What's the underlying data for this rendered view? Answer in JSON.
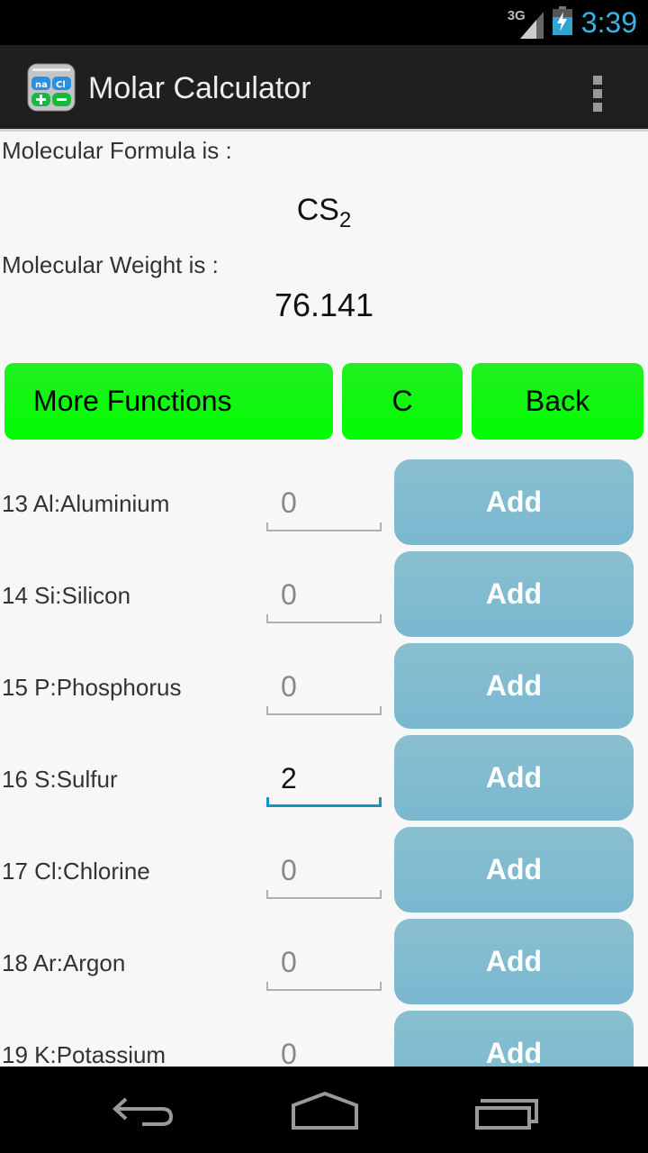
{
  "status_bar": {
    "network": "3G",
    "time": "3:39",
    "battery": "charging"
  },
  "action_bar": {
    "title": "Molar Calculator",
    "icon": "molar-calculator-app-icon",
    "overflow": "overflow-menu-icon"
  },
  "result": {
    "formula_label": "Molecular Formula is :",
    "formula_main": "CS",
    "formula_sub": "2",
    "weight_label": "Molecular Weight is :",
    "weight_value": "76.141"
  },
  "buttons": {
    "more_functions": "More Functions",
    "clear": "C",
    "back": "Back"
  },
  "colors": {
    "green_button": "#00ff00",
    "add_button": "#7ab8d0",
    "accent": "#33b5e5",
    "active_underline": "#0e95c6"
  },
  "elements": [
    {
      "label": "13 Al:Aluminium",
      "value": "0",
      "add": "Add",
      "active": false
    },
    {
      "label": "14 Si:Silicon",
      "value": "0",
      "add": "Add",
      "active": false
    },
    {
      "label": "15 P:Phosphorus",
      "value": "0",
      "add": "Add",
      "active": false
    },
    {
      "label": "16 S:Sulfur",
      "value": "2",
      "add": "Add",
      "active": true
    },
    {
      "label": "17 Cl:Chlorine",
      "value": "0",
      "add": "Add",
      "active": false
    },
    {
      "label": "18 Ar:Argon",
      "value": "0",
      "add": "Add",
      "active": false
    },
    {
      "label": "19 K:Potassium",
      "value": "0",
      "add": "Add",
      "active": false
    }
  ],
  "nav_bar": {
    "back": "back-icon",
    "home": "home-icon",
    "recents": "recents-icon"
  }
}
